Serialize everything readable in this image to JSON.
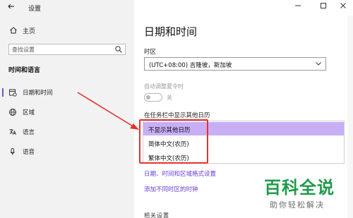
{
  "window": {
    "title": "设置",
    "back_icon": "back-arrow-icon",
    "minimize_icon": "minimize-icon",
    "maximize_icon": "maximize-icon",
    "close_icon": "close-icon"
  },
  "sidebar": {
    "home_label": "主页",
    "home_icon": "home-icon",
    "search_placeholder": "查找设置",
    "section_title": "时间和语言",
    "items": [
      {
        "label": "日期和时间",
        "icon": "calendar-clock-icon",
        "selected": true
      },
      {
        "label": "区域",
        "icon": "globe-icon",
        "selected": false
      },
      {
        "label": "语言",
        "icon": "language-icon",
        "selected": false
      },
      {
        "label": "语音",
        "icon": "microphone-icon",
        "selected": false
      }
    ]
  },
  "main": {
    "page_title": "日期和时间",
    "timezone_label": "时区",
    "timezone_value": "(UTC+08:00) 吉隆坡，新加坡",
    "dst_label": "自动调整夏令时",
    "dst_state": "关",
    "calendar_label": "在任务栏中显示其他日历",
    "calendar_options": [
      {
        "label": "不显示其他日历",
        "selected": true
      },
      {
        "label": "简体中文(农历)",
        "selected": false
      },
      {
        "label": "繁体中文(农历)",
        "selected": false
      }
    ],
    "link_format": "日期、时间和区域格式设置",
    "link_timezones": "添加不同时区的时钟",
    "cut_text": "相关设置"
  },
  "watermark": {
    "main": "百科全说",
    "sub": "助你轻松解决"
  },
  "colors": {
    "accent": "#6b3bd8",
    "selected_option": "#c8aef5",
    "annotation_red": "#e5322c",
    "watermark_green": "#1f9a4a"
  }
}
